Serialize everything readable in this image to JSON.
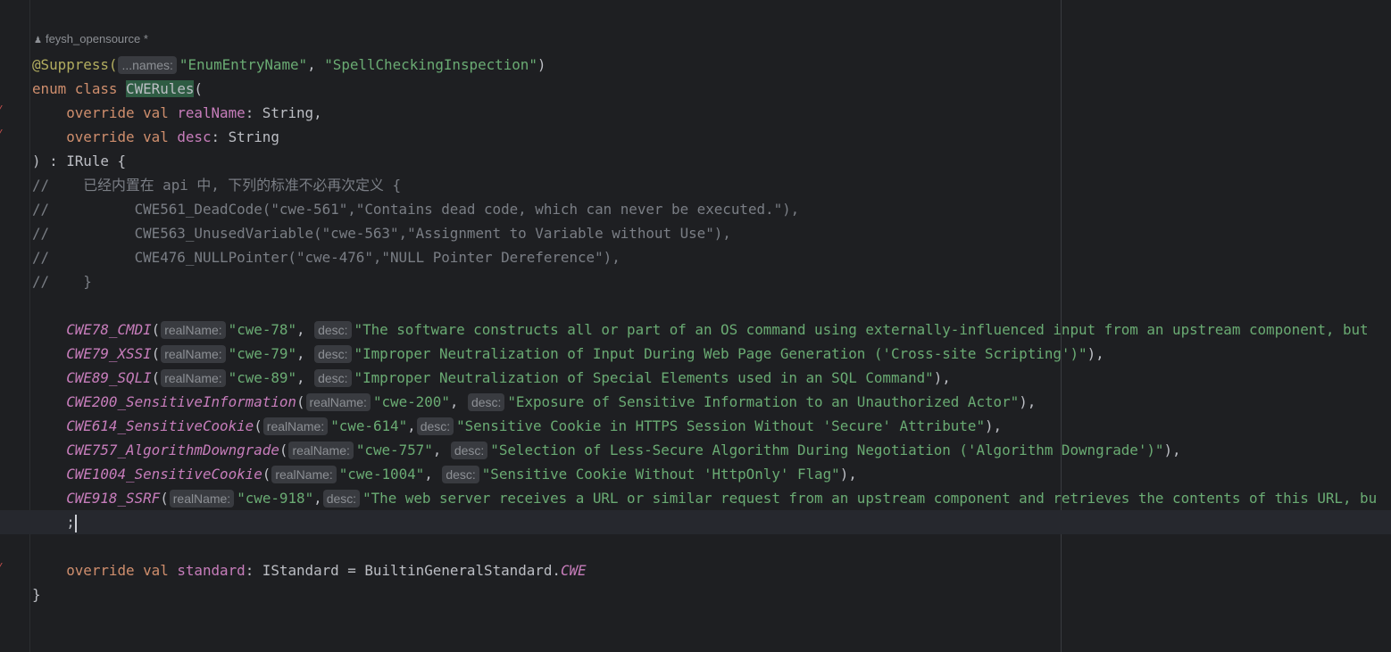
{
  "author": {
    "icon": "person-icon",
    "name": "feysh_opensource *"
  },
  "colors": {
    "background": "#1e1f22",
    "keyword": "#cf8e6d",
    "string": "#6aab73",
    "annotation": "#b3ae60",
    "property": "#c77dbb",
    "comment": "#7a7e85",
    "hint_bg": "#393b40",
    "current_line": "#26282e"
  },
  "lines": [
    {
      "tokens": [
        {
          "t": "@Suppress(",
          "c": "a"
        },
        {
          "t": "...names:",
          "c": "h"
        },
        {
          "t": "\"EnumEntryName\"",
          "c": "s"
        },
        {
          "t": ", ",
          "c": "t"
        },
        {
          "t": "\"SpellCheckingInspection\"",
          "c": "s"
        },
        {
          "t": ")",
          "c": "t"
        }
      ]
    },
    {
      "tokens": [
        {
          "t": "enum class ",
          "c": "k"
        },
        {
          "t": "CWERules",
          "c": "t sel"
        },
        {
          "t": "(",
          "c": "t"
        }
      ]
    },
    {
      "tokens": [
        {
          "t": "    override val ",
          "c": "k"
        },
        {
          "t": "realName",
          "c": "p"
        },
        {
          "t": ": String,",
          "c": "t"
        }
      ]
    },
    {
      "tokens": [
        {
          "t": "    override val ",
          "c": "k"
        },
        {
          "t": "desc",
          "c": "p"
        },
        {
          "t": ": String",
          "c": "t"
        }
      ]
    },
    {
      "tokens": [
        {
          "t": ") : IRule {",
          "c": "t"
        }
      ]
    },
    {
      "tokens": [
        {
          "t": "//    已经内置在 api 中, 下列的标准不必再次定义 {",
          "c": "c"
        }
      ]
    },
    {
      "tokens": [
        {
          "t": "//          CWE561_DeadCode(\"cwe-561\",\"Contains dead code, which can never be executed.\"),",
          "c": "c"
        }
      ]
    },
    {
      "tokens": [
        {
          "t": "//          CWE563_UnusedVariable(\"cwe-563\",\"Assignment to Variable without Use\"),",
          "c": "c"
        }
      ]
    },
    {
      "tokens": [
        {
          "t": "//          CWE476_NULLPointer(\"cwe-476\",\"NULL Pointer Dereference\"),",
          "c": "c"
        }
      ]
    },
    {
      "tokens": [
        {
          "t": "//    }",
          "c": "c"
        }
      ]
    },
    {
      "tokens": []
    },
    {
      "tokens": [
        {
          "t": "    CWE78_CMDI",
          "c": "pi"
        },
        {
          "t": "(",
          "c": "t"
        },
        {
          "t": "realName:",
          "c": "h"
        },
        {
          "t": "\"cwe-78\"",
          "c": "s"
        },
        {
          "t": ", ",
          "c": "t"
        },
        {
          "t": "desc:",
          "c": "h"
        },
        {
          "t": "\"The software constructs all or part of an OS command using externally-influenced input from an upstream component, but",
          "c": "s"
        }
      ]
    },
    {
      "tokens": [
        {
          "t": "    CWE79_XSSI",
          "c": "pi"
        },
        {
          "t": "(",
          "c": "t"
        },
        {
          "t": "realName:",
          "c": "h"
        },
        {
          "t": "\"cwe-79\"",
          "c": "s"
        },
        {
          "t": ", ",
          "c": "t"
        },
        {
          "t": "desc:",
          "c": "h"
        },
        {
          "t": "\"Improper Neutralization of Input During Web Page Generation ('Cross-site Scripting')\"",
          "c": "s"
        },
        {
          "t": "),",
          "c": "t"
        }
      ]
    },
    {
      "tokens": [
        {
          "t": "    CWE89_SQLI",
          "c": "pi"
        },
        {
          "t": "(",
          "c": "t"
        },
        {
          "t": "realName:",
          "c": "h"
        },
        {
          "t": "\"cwe-89\"",
          "c": "s"
        },
        {
          "t": ", ",
          "c": "t"
        },
        {
          "t": "desc:",
          "c": "h"
        },
        {
          "t": "\"Improper Neutralization of Special Elements used in an SQL Command\"",
          "c": "s"
        },
        {
          "t": "),",
          "c": "t"
        }
      ]
    },
    {
      "tokens": [
        {
          "t": "    CWE200_SensitiveInformation",
          "c": "pi"
        },
        {
          "t": "(",
          "c": "t"
        },
        {
          "t": "realName:",
          "c": "h"
        },
        {
          "t": "\"cwe-200\"",
          "c": "s"
        },
        {
          "t": ", ",
          "c": "t"
        },
        {
          "t": "desc:",
          "c": "h"
        },
        {
          "t": "\"Exposure of Sensitive Information to an Unauthorized Actor\"",
          "c": "s"
        },
        {
          "t": "),",
          "c": "t"
        }
      ]
    },
    {
      "tokens": [
        {
          "t": "    CWE614_SensitiveCookie",
          "c": "pi"
        },
        {
          "t": "(",
          "c": "t"
        },
        {
          "t": "realName:",
          "c": "h"
        },
        {
          "t": "\"cwe-614\"",
          "c": "s"
        },
        {
          "t": ",",
          "c": "t"
        },
        {
          "t": "desc:",
          "c": "h"
        },
        {
          "t": "\"Sensitive Cookie in HTTPS Session Without 'Secure' Attribute\"",
          "c": "s"
        },
        {
          "t": "),",
          "c": "t"
        }
      ]
    },
    {
      "tokens": [
        {
          "t": "    CWE757_AlgorithmDowngrade",
          "c": "pi"
        },
        {
          "t": "(",
          "c": "t"
        },
        {
          "t": "realName:",
          "c": "h"
        },
        {
          "t": "\"cwe-757\"",
          "c": "s"
        },
        {
          "t": ", ",
          "c": "t"
        },
        {
          "t": "desc:",
          "c": "h"
        },
        {
          "t": "\"Selection of Less-Secure Algorithm During Negotiation ('Algorithm Downgrade')\"",
          "c": "s"
        },
        {
          "t": "),",
          "c": "t"
        }
      ]
    },
    {
      "tokens": [
        {
          "t": "    CWE1004_SensitiveCookie",
          "c": "pi"
        },
        {
          "t": "(",
          "c": "t"
        },
        {
          "t": "realName:",
          "c": "h"
        },
        {
          "t": "\"cwe-1004\"",
          "c": "s"
        },
        {
          "t": ", ",
          "c": "t"
        },
        {
          "t": "desc:",
          "c": "h"
        },
        {
          "t": "\"Sensitive Cookie Without 'HttpOnly' Flag\"",
          "c": "s"
        },
        {
          "t": "),",
          "c": "t"
        }
      ]
    },
    {
      "tokens": [
        {
          "t": "    CWE918_SSRF",
          "c": "pi"
        },
        {
          "t": "(",
          "c": "t"
        },
        {
          "t": "realName:",
          "c": "h"
        },
        {
          "t": "\"cwe-918\"",
          "c": "s"
        },
        {
          "t": ",",
          "c": "t"
        },
        {
          "t": "desc:",
          "c": "h"
        },
        {
          "t": "\"The web server receives a URL or similar request from an upstream component and retrieves the contents of this URL, bu",
          "c": "s"
        }
      ]
    },
    {
      "current": true,
      "tokens": [
        {
          "t": "    ;",
          "c": "t"
        }
      ]
    },
    {
      "tokens": []
    },
    {
      "tokens": [
        {
          "t": "    override val ",
          "c": "k"
        },
        {
          "t": "standard",
          "c": "p"
        },
        {
          "t": ": IStandard = BuiltinGeneralStandard.",
          "c": "t"
        },
        {
          "t": "CWE",
          "c": "pi"
        }
      ]
    },
    {
      "tokens": [
        {
          "t": "}",
          "c": "t"
        }
      ]
    }
  ]
}
